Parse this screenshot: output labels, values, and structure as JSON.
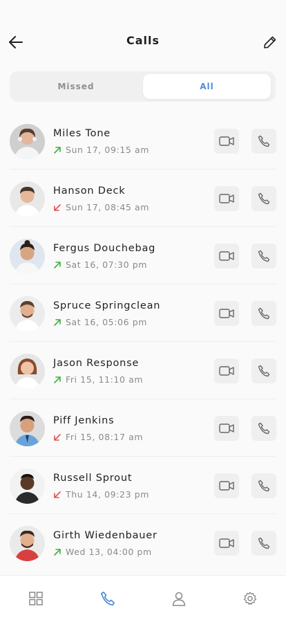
{
  "header": {
    "title": "Calls"
  },
  "tabs": {
    "missed": "Missed",
    "all": "All",
    "active": "All"
  },
  "colors": {
    "accent": "#4a90d9",
    "outgoing": "#3fae3f",
    "incoming": "#d9534f"
  },
  "calls": [
    {
      "name": "Miles Tone",
      "time": "Sun 17, 09:15 am",
      "direction": "outgoing"
    },
    {
      "name": "Hanson Deck",
      "time": "Sun 17, 08:45 am",
      "direction": "incoming"
    },
    {
      "name": "Fergus Douchebag",
      "time": "Sat 16, 07:30 pm",
      "direction": "outgoing"
    },
    {
      "name": "Spruce Springclean",
      "time": "Sat 16, 05:06 pm",
      "direction": "outgoing"
    },
    {
      "name": "Jason Response",
      "time": "Fri 15, 11:10 am",
      "direction": "outgoing"
    },
    {
      "name": "Piff Jenkins",
      "time": "Fri 15, 08:17 am",
      "direction": "incoming"
    },
    {
      "name": "Russell Sprout",
      "time": "Thu 14, 09:23 pm",
      "direction": "incoming"
    },
    {
      "name": "Girth Wiedenbauer",
      "time": "Wed 13, 04:00 pm",
      "direction": "outgoing"
    }
  ],
  "nav": {
    "items": [
      "grid-icon",
      "phone-icon",
      "user-icon",
      "gear-icon"
    ],
    "active": "phone-icon"
  }
}
